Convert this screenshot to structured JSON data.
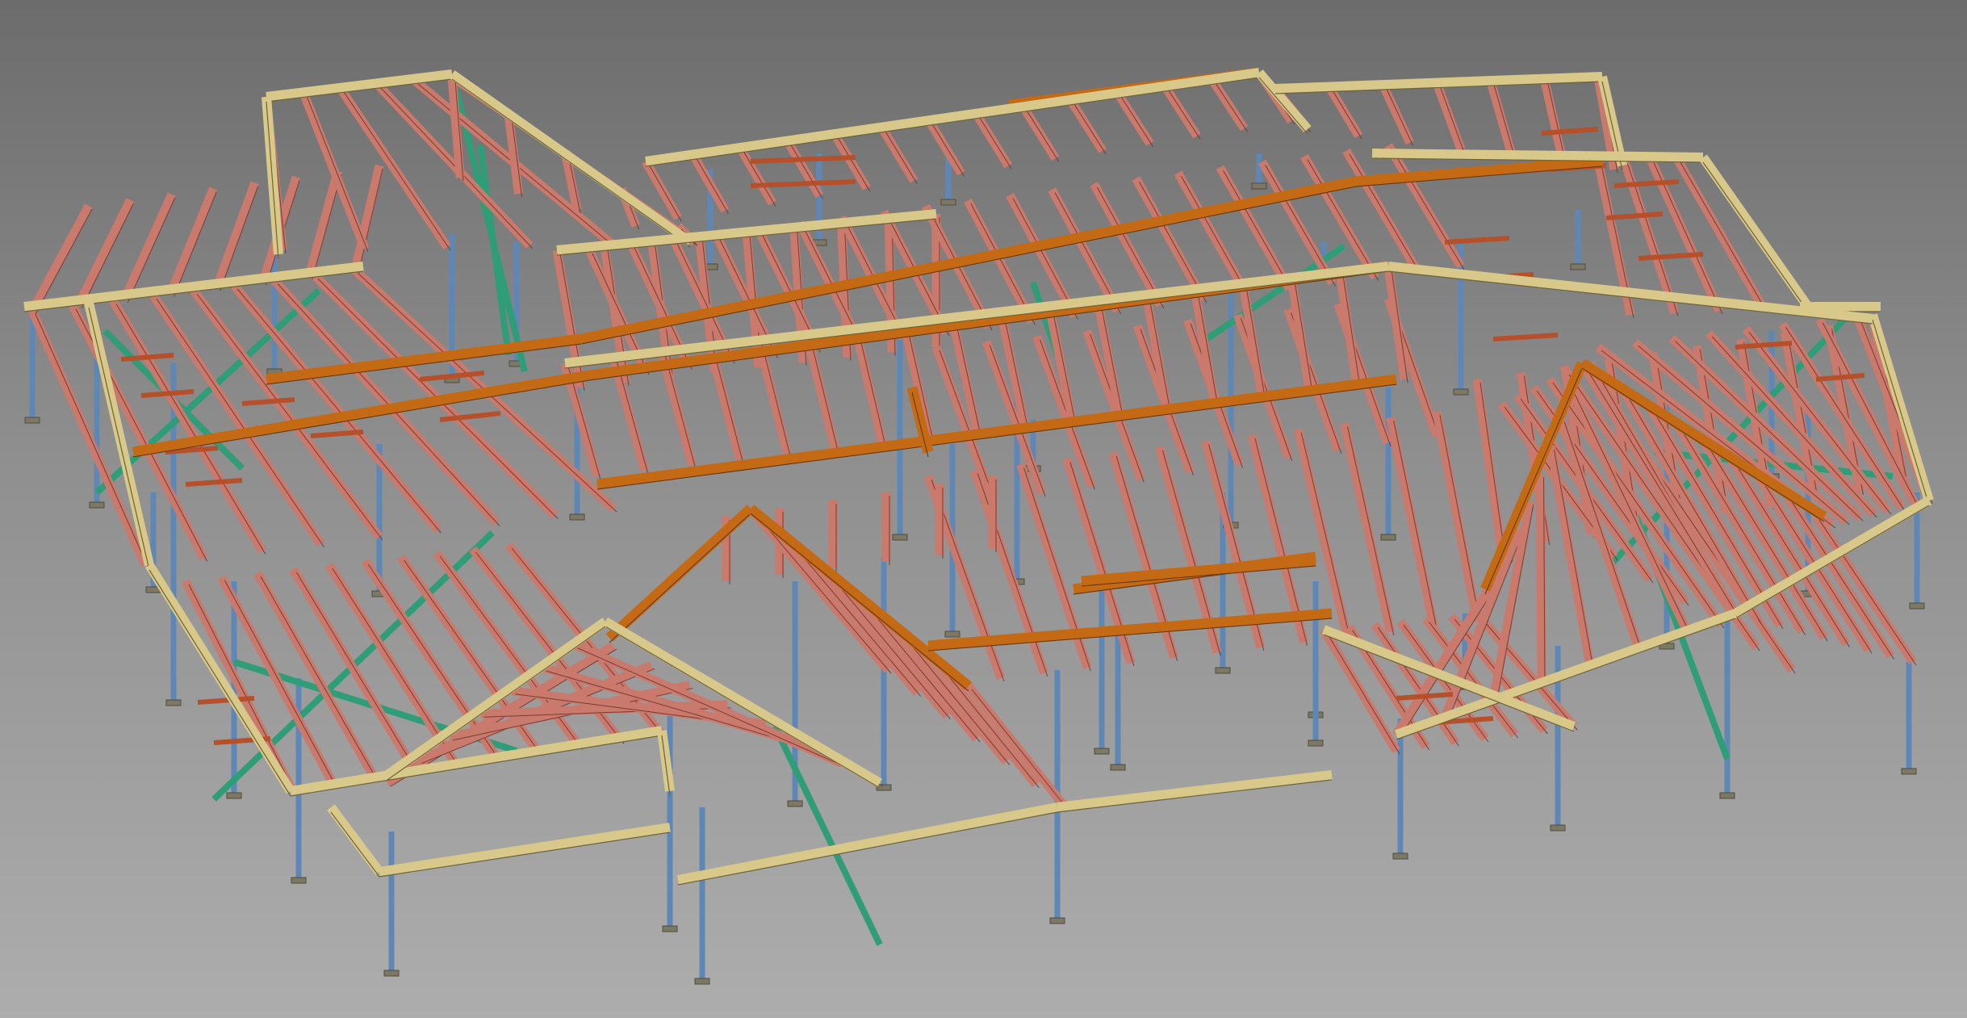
{
  "scene": {
    "subject": "timber-roof-frame-3d-model",
    "background_colors": [
      "#6c6c6c",
      "#8f8f8f",
      "#adadad"
    ],
    "material_colors": {
      "rafter": "#c97a6c",
      "hip_beam": "#c46a14",
      "fascia": "#d8c98a",
      "steel_post": "#5f87b6",
      "bracing": "#2f9d78",
      "purlin": "#b5502b"
    }
  }
}
